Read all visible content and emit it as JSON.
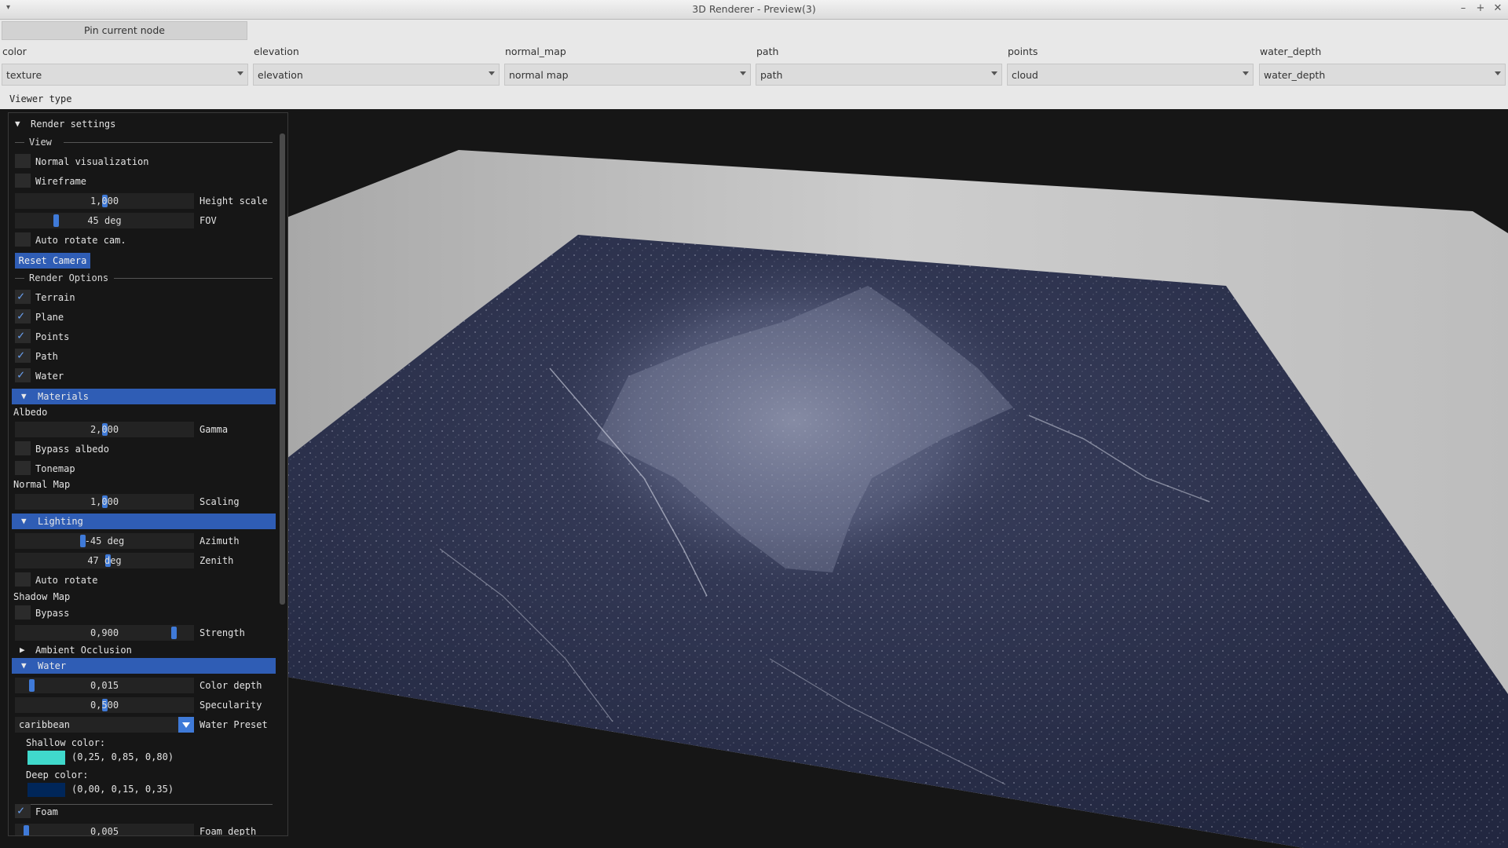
{
  "window": {
    "title": "3D Renderer - Preview(3)",
    "controls": [
      "–",
      "+",
      "✕"
    ]
  },
  "toolbar": {
    "pin_label": "Pin current node",
    "combos": [
      {
        "label": "color",
        "value": "texture"
      },
      {
        "label": "elevation",
        "value": "elevation"
      },
      {
        "label": "normal_map",
        "value": "normal map"
      },
      {
        "label": "path",
        "value": "path"
      },
      {
        "label": "points",
        "value": "cloud"
      },
      {
        "label": "water_depth",
        "value": "water_depth"
      }
    ],
    "viewer_type_label": "Viewer type"
  },
  "panel": {
    "render_settings": "Render settings",
    "view_sep": "View",
    "normal_vis": "Normal visualization",
    "wireframe": "Wireframe",
    "height_scale": {
      "value": "1,000",
      "label": "Height scale",
      "fraction": 0.5
    },
    "fov": {
      "value": "45 deg",
      "label": "FOV",
      "fraction": 0.22
    },
    "auto_rotate_cam": "Auto rotate cam.",
    "reset_camera": "Reset Camera",
    "render_options_sep": "Render Options",
    "options": [
      {
        "label": "Terrain",
        "checked": true
      },
      {
        "label": "Plane",
        "checked": true
      },
      {
        "label": "Points",
        "checked": true
      },
      {
        "label": "Path",
        "checked": true
      },
      {
        "label": "Water",
        "checked": true
      }
    ],
    "materials": "Materials",
    "albedo": "Albedo",
    "gamma": {
      "value": "2,000",
      "label": "Gamma",
      "fraction": 0.5
    },
    "bypass_albedo": "Bypass albedo",
    "tonemap": "Tonemap",
    "normal_map": "Normal Map",
    "scaling": {
      "value": "1,000",
      "label": "Scaling",
      "fraction": 0.5
    },
    "lighting": "Lighting",
    "azimuth": {
      "value": "-45 deg",
      "label": "Azimuth",
      "fraction": 0.375
    },
    "zenith": {
      "value": "47 deg",
      "label": "Zenith",
      "fraction": 0.52
    },
    "auto_rotate": "Auto rotate",
    "shadow_map": "Shadow Map",
    "bypass": "Bypass",
    "strength": {
      "value": "0,900",
      "label": "Strength",
      "fraction": 0.9
    },
    "ambient_occlusion": "Ambient Occlusion",
    "water": "Water",
    "color_depth": {
      "value": "0,015",
      "label": "Color depth",
      "fraction": 0.08
    },
    "specularity": {
      "value": "0,500",
      "label": "Specularity",
      "fraction": 0.5
    },
    "water_preset": {
      "value": "caribbean",
      "label": "Water Preset"
    },
    "shallow_color": {
      "label": "Shallow color:",
      "value": "(0,25, 0,85, 0,80)",
      "swatch": "#40d9cc"
    },
    "deep_color": {
      "label": "Deep color:",
      "value": "(0,00, 0,15, 0,35)",
      "swatch": "#002659"
    },
    "foam": {
      "label": "Foam",
      "checked": true
    },
    "foam_depth": {
      "value": "0,005",
      "label": "Foam depth",
      "fraction": 0.05
    }
  },
  "colors": {
    "accent": "#2f5db5",
    "panel_bg": "#161616",
    "terrain": "#2b304b",
    "plane": "#c8c8c8"
  }
}
